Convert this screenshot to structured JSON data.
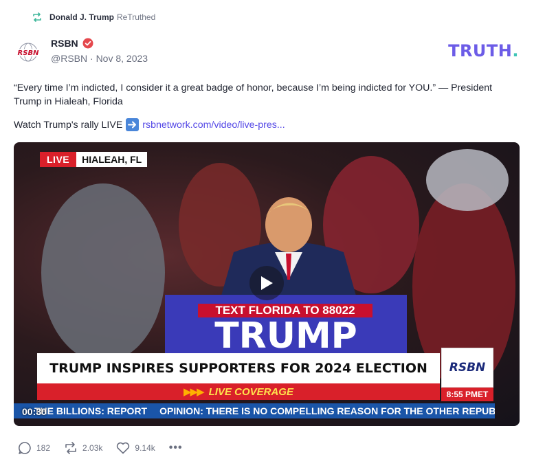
{
  "retruth": {
    "name": "Donald J. Trump",
    "label": "ReTruthed",
    "icon": "retruth-icon"
  },
  "author": {
    "name": "RSBN",
    "handle": "@RSBN",
    "date": "Nov 8, 2023",
    "avatar_text": "RSBN",
    "verified_color": "#e5484d"
  },
  "brand": {
    "logo_text": "TRUTH",
    "logo_dot": ".",
    "color": "#6c5ce7"
  },
  "post": {
    "text": "“Every time I’m indicted, I consider it a great badge of honor, because I’m being indicted for YOU.” — President Trump in Hialeah, Florida",
    "watch_prefix": "Watch Trump's rally LIVE",
    "link_text": "rsbnetwork.com/video/live-pres..."
  },
  "video": {
    "live_label": "LIVE",
    "location": "HIALEAH, FL",
    "podium_sign_top": "TEXT FLORIDA TO 88022",
    "podium_sign_main": "TRUMP",
    "headline": "TRUMP INSPIRES SUPPORTERS FOR 2024 ELECTION",
    "subheadline": "LIVE COVERAGE",
    "corner_logo": "RSBN",
    "time": "8:55 PMET",
    "ticker_1": "THE BILLIONS: REPORT",
    "ticker_2": "OPINION: THERE IS NO COMPELLING REASON FOR THE OTHER REPUBLIC",
    "timestamp": "00:30"
  },
  "actions": {
    "replies": "182",
    "retruths": "2.03k",
    "likes": "9.14k",
    "more": "•••"
  }
}
